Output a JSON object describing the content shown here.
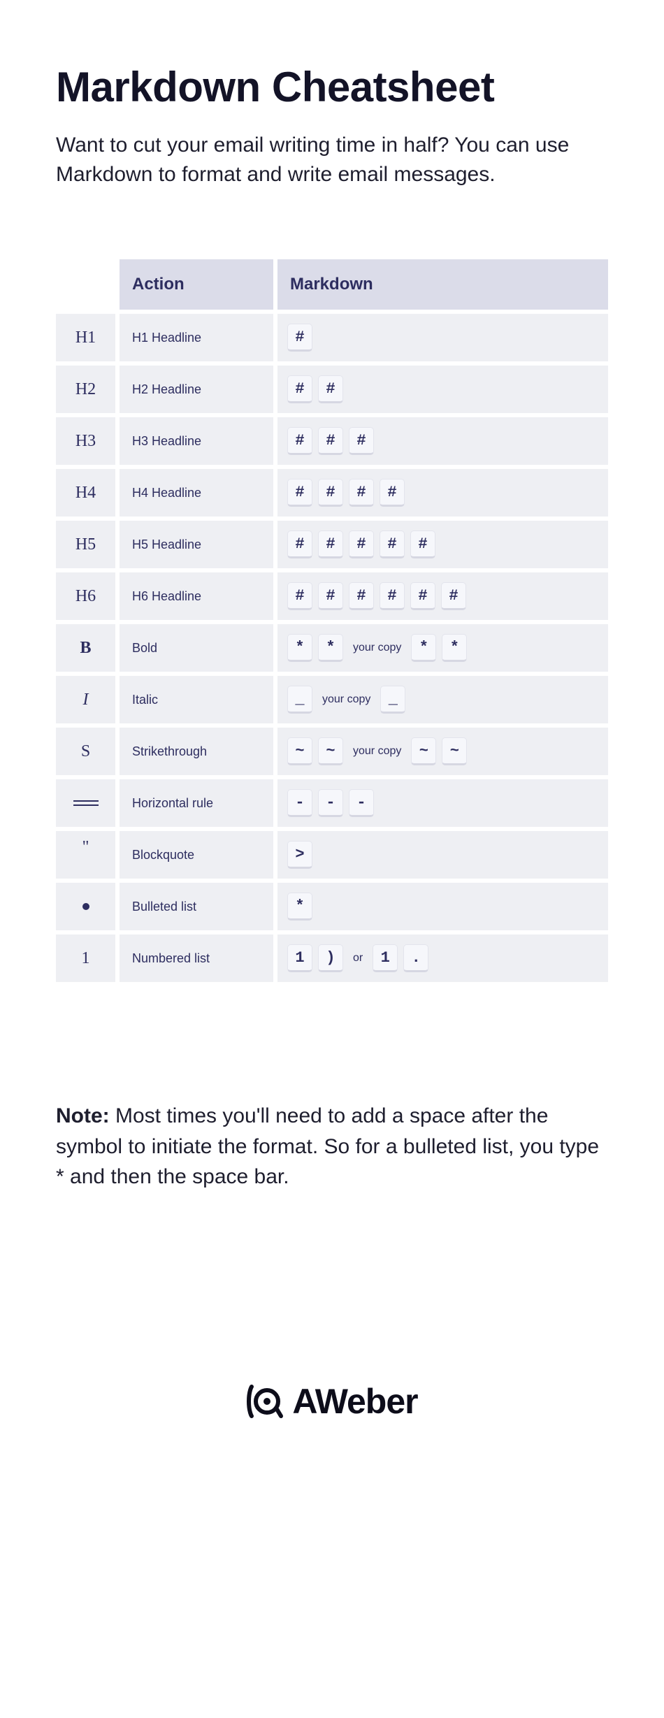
{
  "title": "Markdown Cheatsheet",
  "intro": "Want to cut your email writing time in half? You can use Markdown to format and write email messages.",
  "headers": {
    "action": "Action",
    "markdown": "Markdown"
  },
  "rows": [
    {
      "icon_type": "text",
      "icon": "H1",
      "action": "H1 Headline",
      "md": [
        {
          "t": "key",
          "v": "#"
        }
      ]
    },
    {
      "icon_type": "text",
      "icon": "H2",
      "action": "H2 Headline",
      "md": [
        {
          "t": "key",
          "v": "#"
        },
        {
          "t": "key",
          "v": "#"
        }
      ]
    },
    {
      "icon_type": "text",
      "icon": "H3",
      "action": "H3 Headline",
      "md": [
        {
          "t": "key",
          "v": "#"
        },
        {
          "t": "key",
          "v": "#"
        },
        {
          "t": "key",
          "v": "#"
        }
      ]
    },
    {
      "icon_type": "text",
      "icon": "H4",
      "action": "H4 Headline",
      "md": [
        {
          "t": "key",
          "v": "#"
        },
        {
          "t": "key",
          "v": "#"
        },
        {
          "t": "key",
          "v": "#"
        },
        {
          "t": "key",
          "v": "#"
        }
      ]
    },
    {
      "icon_type": "text",
      "icon": "H5",
      "action": "H5 Headline",
      "md": [
        {
          "t": "key",
          "v": "#"
        },
        {
          "t": "key",
          "v": "#"
        },
        {
          "t": "key",
          "v": "#"
        },
        {
          "t": "key",
          "v": "#"
        },
        {
          "t": "key",
          "v": "#"
        }
      ]
    },
    {
      "icon_type": "text",
      "icon": "H6",
      "action": "H6 Headline",
      "md": [
        {
          "t": "key",
          "v": "#"
        },
        {
          "t": "key",
          "v": "#"
        },
        {
          "t": "key",
          "v": "#"
        },
        {
          "t": "key",
          "v": "#"
        },
        {
          "t": "key",
          "v": "#"
        },
        {
          "t": "key",
          "v": "#"
        }
      ]
    },
    {
      "icon_type": "bold",
      "icon": "B",
      "action": "Bold",
      "md": [
        {
          "t": "key",
          "v": "*"
        },
        {
          "t": "key",
          "v": "*"
        },
        {
          "t": "text",
          "v": "your copy"
        },
        {
          "t": "key",
          "v": "*"
        },
        {
          "t": "key",
          "v": "*"
        }
      ]
    },
    {
      "icon_type": "italic",
      "icon": "I",
      "action": "Italic",
      "md": [
        {
          "t": "key",
          "v": "_"
        },
        {
          "t": "text",
          "v": "your copy"
        },
        {
          "t": "key",
          "v": "_"
        }
      ]
    },
    {
      "icon_type": "text",
      "icon": "S",
      "action": "Strikethrough",
      "md": [
        {
          "t": "key",
          "v": "~"
        },
        {
          "t": "key",
          "v": "~"
        },
        {
          "t": "text",
          "v": "your copy"
        },
        {
          "t": "key",
          "v": "~"
        },
        {
          "t": "key",
          "v": "~"
        }
      ]
    },
    {
      "icon_type": "hr",
      "icon": "",
      "action": "Horizontal rule",
      "md": [
        {
          "t": "key",
          "v": "-"
        },
        {
          "t": "key",
          "v": "-"
        },
        {
          "t": "key",
          "v": "-"
        }
      ]
    },
    {
      "icon_type": "quote",
      "icon": "\"",
      "action": "Blockquote",
      "md": [
        {
          "t": "key",
          "v": ">"
        }
      ]
    },
    {
      "icon_type": "bullet",
      "icon": "",
      "action": "Bulleted list",
      "md": [
        {
          "t": "key",
          "v": "*"
        }
      ]
    },
    {
      "icon_type": "text",
      "icon": "1",
      "action": "Numbered list",
      "md": [
        {
          "t": "key",
          "v": "1"
        },
        {
          "t": "key",
          "v": ")"
        },
        {
          "t": "text",
          "v": "or"
        },
        {
          "t": "key",
          "v": "1"
        },
        {
          "t": "key",
          "v": "."
        }
      ]
    }
  ],
  "note_label": "Note:",
  "note_text": " Most times you'll need to add a space after the symbol to initiate the format. So for a bulleted list, you type * and then the space bar.",
  "logo": "AWeber"
}
